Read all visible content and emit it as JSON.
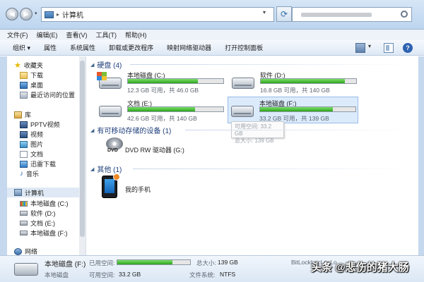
{
  "address": {
    "location": "计算机",
    "separator": "▸"
  },
  "menu": [
    "文件(F)",
    "编辑(E)",
    "查看(V)",
    "工具(T)",
    "帮助(H)"
  ],
  "toolbar": {
    "organize": "组织 ▾",
    "items": [
      "属性",
      "系统属性",
      "卸载或更改程序",
      "映射网络驱动器",
      "打开控制面板"
    ],
    "help_label": "?"
  },
  "sidebar": {
    "favorites": "收藏夹",
    "fav_items": [
      "下载",
      "桌面",
      "最近访问的位置"
    ],
    "libraries": "库",
    "lib_items": [
      "PPTV视频",
      "视频",
      "图片",
      "文档",
      "迅雷下载",
      "音乐"
    ],
    "computer": "计算机",
    "drives": [
      "本地磁盘 (C:)",
      "软件 (D:)",
      "文档 (E:)",
      "本地磁盘 (F:)"
    ],
    "network": "网络"
  },
  "sections": {
    "hdd": "硬盘 (4)",
    "removable": "有可移动存储的设备 (1)",
    "other": "其他 (1)"
  },
  "drives": [
    {
      "name": "本地磁盘 (C:)",
      "info": "12.3 GB 可用，共 46.0 GB",
      "used_fraction": 0.73,
      "windows": true
    },
    {
      "name": "软件 (D:)",
      "info": "16.8 GB 可用，共 140 GB",
      "used_fraction": 0.88,
      "windows": false
    },
    {
      "name": "文档 (E:)",
      "info": "42.6 GB 可用，共 140 GB",
      "used_fraction": 0.7,
      "windows": false
    },
    {
      "name": "本地磁盘 (F:)",
      "info": "33.2 GB 可用，共 139 GB",
      "used_fraction": 0.76,
      "windows": false
    }
  ],
  "tooltip": {
    "line1": "可用空间: 33.2 GB",
    "line2": "总大小: 139 GB"
  },
  "dvd": {
    "name": "DVD RW 驱动器 (G:)",
    "label": "DVD"
  },
  "phone": {
    "name": "我的手机"
  },
  "details": {
    "name": "本地磁盘 (F:)",
    "type": "本地磁盘",
    "used_label": "已用空间:",
    "free_label": "可用空间:",
    "free_value": "33.2 GB",
    "total_label": "总大小:",
    "total_value": "139 GB",
    "fs_label": "文件系统:",
    "fs_value": "NTFS",
    "bitlocker": "BitLockLocLocLo",
    "used_fraction": 0.76
  },
  "watermark": "头条 @悲伤的猪大肠",
  "colors": {
    "bar_fill": "#2fa31d",
    "selection": "#dcebfb",
    "section_text": "#1e3f7a"
  }
}
